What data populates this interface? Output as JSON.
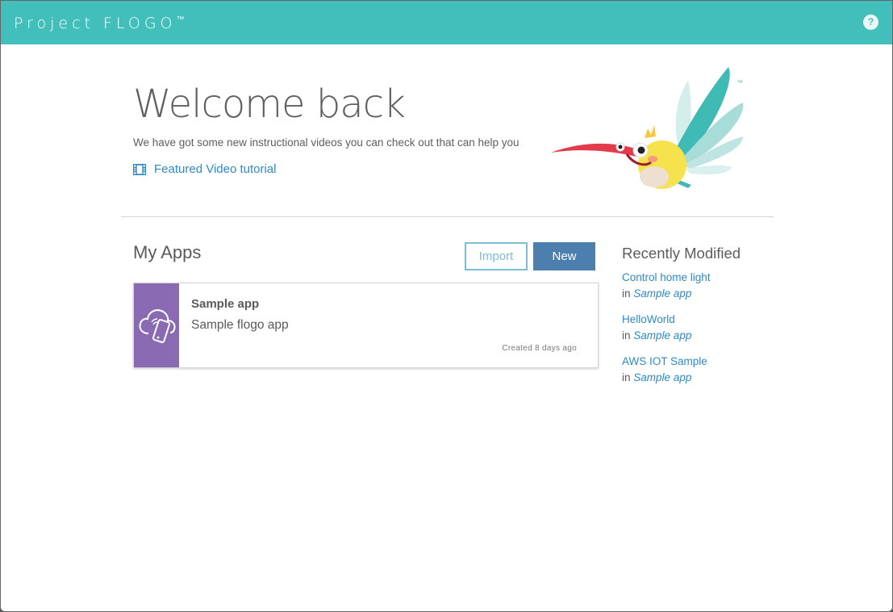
{
  "header": {
    "brand": "Project FLOGO",
    "brand_tm": "™",
    "help_label": "?",
    "colors": {
      "bar": "#42bfba"
    }
  },
  "welcome": {
    "title": "Welcome back",
    "subtitle": "We have got some new instructional videos you can check out that can help you",
    "video_link_icon": "film-icon",
    "video_link": "Featured Video tutorial",
    "mascot_tm": "™"
  },
  "my_apps": {
    "title": "My Apps",
    "import_label": "Import",
    "new_label": "New",
    "apps": [
      {
        "name": "Sample app",
        "description": "Sample flogo app",
        "created": "Created 8 days ago",
        "icon": "cloud-phone-icon",
        "color": "#8a6ab3"
      }
    ]
  },
  "recently_modified": {
    "title": "Recently Modified",
    "in_label": "in",
    "items": [
      {
        "flow": "Control home light",
        "app": "Sample app"
      },
      {
        "flow": "HelloWorld",
        "app": "Sample app"
      },
      {
        "flow": "AWS IOT Sample",
        "app": "Sample app"
      }
    ]
  }
}
